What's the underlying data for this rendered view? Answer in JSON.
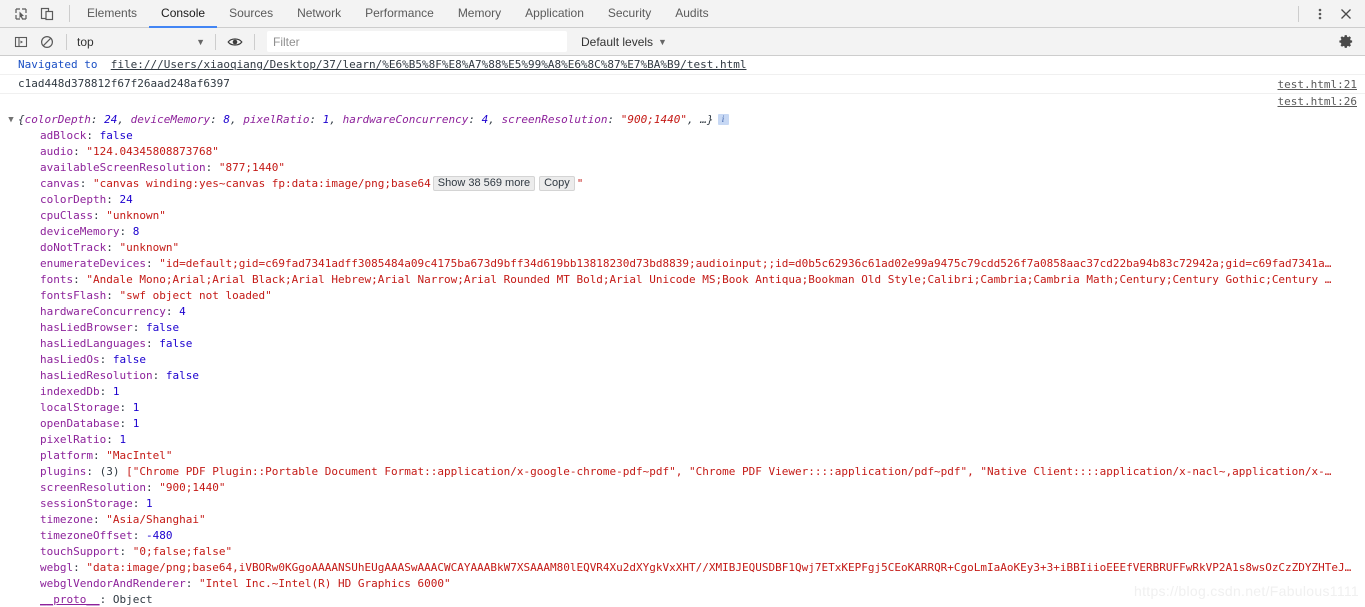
{
  "tabbar": {
    "inspect_icon": "inspect-element-icon",
    "device_icon": "device-toolbar-icon",
    "tabs": [
      {
        "label": "Elements",
        "active": false
      },
      {
        "label": "Console",
        "active": true
      },
      {
        "label": "Sources",
        "active": false
      },
      {
        "label": "Network",
        "active": false
      },
      {
        "label": "Performance",
        "active": false
      },
      {
        "label": "Memory",
        "active": false
      },
      {
        "label": "Application",
        "active": false
      },
      {
        "label": "Security",
        "active": false
      },
      {
        "label": "Audits",
        "active": false
      }
    ],
    "more_icon": "kebab-menu-icon",
    "close_icon": "close-icon"
  },
  "filterbar": {
    "sidebar_toggle_icon": "console-sidebar-icon",
    "clear_icon": "clear-console-icon",
    "context": "top",
    "context_caret": "▼",
    "eye_icon": "live-expression-eye-icon",
    "filter_placeholder": "Filter",
    "filter_value": "",
    "levels_label": "Default levels",
    "levels_caret": "▼",
    "settings_icon": "gear-icon"
  },
  "console": {
    "navigated": {
      "label": "Navigated to",
      "url": "file:///Users/xiaoqiang/Desktop/37/learn/%E6%B5%8F%E8%A7%88%E5%99%A8%E6%8C%87%E7%BA%B9/test.html"
    },
    "hash_line": {
      "text": "c1ad448d378812f67f26aad248af6397",
      "source": "test.html:21"
    },
    "object_source": "test.html:26",
    "object_preview": {
      "open_arrow": "▼",
      "open_brace": "{",
      "close": ", …}",
      "entries": [
        {
          "key": "colorDepth",
          "value": "24",
          "type": "num"
        },
        {
          "key": "deviceMemory",
          "value": "8",
          "type": "num"
        },
        {
          "key": "pixelRatio",
          "value": "1",
          "type": "num"
        },
        {
          "key": "hardwareConcurrency",
          "value": "4",
          "type": "num"
        },
        {
          "key": "screenResolution",
          "value": "\"900;1440\"",
          "type": "str"
        }
      ],
      "info_badge": "i"
    },
    "properties": [
      {
        "key": "adBlock",
        "value": "false",
        "type": "bool"
      },
      {
        "key": "audio",
        "value": "\"124.04345808873768\"",
        "type": "str"
      },
      {
        "key": "availableScreenResolution",
        "value": "\"877;1440\"",
        "type": "str"
      },
      {
        "key": "canvas",
        "type": "canvas",
        "prefix": "\"canvas winding:yes~canvas fp:data:image/png;base64",
        "button_show": "Show 38 569 more",
        "button_copy": "Copy",
        "suffix": "\""
      },
      {
        "key": "colorDepth",
        "value": "24",
        "type": "num"
      },
      {
        "key": "cpuClass",
        "value": "\"unknown\"",
        "type": "str"
      },
      {
        "key": "deviceMemory",
        "value": "8",
        "type": "num"
      },
      {
        "key": "doNotTrack",
        "value": "\"unknown\"",
        "type": "str"
      },
      {
        "key": "enumerateDevices",
        "value": "\"id=default;gid=c69fad7341adff3085484a09c4175ba673d9bff34d619bb13818230d73bd8839;audioinput;;id=d0b5c62936c61ad02e99a9475c79cdd526f7a0858aac37cd22ba94b83c72942a;gid=c69fad7341a…",
        "type": "str"
      },
      {
        "key": "fonts",
        "value": "\"Andale Mono;Arial;Arial Black;Arial Hebrew;Arial Narrow;Arial Rounded MT Bold;Arial Unicode MS;Book Antiqua;Bookman Old Style;Calibri;Cambria;Cambria Math;Century;Century Gothic;Century …",
        "type": "str"
      },
      {
        "key": "fontsFlash",
        "value": "\"swf object not loaded\"",
        "type": "str"
      },
      {
        "key": "hardwareConcurrency",
        "value": "4",
        "type": "num"
      },
      {
        "key": "hasLiedBrowser",
        "value": "false",
        "type": "bool"
      },
      {
        "key": "hasLiedLanguages",
        "value": "false",
        "type": "bool"
      },
      {
        "key": "hasLiedOs",
        "value": "false",
        "type": "bool"
      },
      {
        "key": "hasLiedResolution",
        "value": "false",
        "type": "bool"
      },
      {
        "key": "indexedDb",
        "value": "1",
        "type": "num"
      },
      {
        "key": "localStorage",
        "value": "1",
        "type": "num"
      },
      {
        "key": "openDatabase",
        "value": "1",
        "type": "num"
      },
      {
        "key": "pixelRatio",
        "value": "1",
        "type": "num"
      },
      {
        "key": "platform",
        "value": "\"MacIntel\"",
        "type": "str"
      },
      {
        "key": "plugins",
        "type": "array",
        "arrow": "▶",
        "count": "(3)",
        "value": "[\"Chrome PDF Plugin::Portable Document Format::application/x-google-chrome-pdf~pdf\", \"Chrome PDF Viewer::::application/pdf~pdf\", \"Native Client::::application/x-nacl~,application/x-…"
      },
      {
        "key": "screenResolution",
        "value": "\"900;1440\"",
        "type": "str"
      },
      {
        "key": "sessionStorage",
        "value": "1",
        "type": "num"
      },
      {
        "key": "timezone",
        "value": "\"Asia/Shanghai\"",
        "type": "str"
      },
      {
        "key": "timezoneOffset",
        "value": "-480",
        "type": "num"
      },
      {
        "key": "touchSupport",
        "value": "\"0;false;false\"",
        "type": "str"
      },
      {
        "key": "webgl",
        "value": "\"data:image/png;base64,iVBORw0KGgoAAAANSUhEUgAAASwAAACWCAYAAABkW7XSAAAM80lEQVR4Xu2dXYgkVxXHT//XMIBJEQUSDBF1Qwj7ETxKEPFgj5CEoKARRQR+CgoLmIaAoKEy3+3+iBBIiioEEEfVERBRUFFwRkVP2A1s8wsOzCzZDYZHTeJ…",
        "type": "str"
      },
      {
        "key": "webglVendorAndRenderer",
        "value": "\"Intel Inc.~Intel(R) HD Graphics 6000\"",
        "type": "str"
      }
    ],
    "proto": {
      "arrow": "▶",
      "key": "__proto__",
      "value": "Object"
    }
  },
  "watermark": "https://blog.csdn.net/Fabulous1111"
}
